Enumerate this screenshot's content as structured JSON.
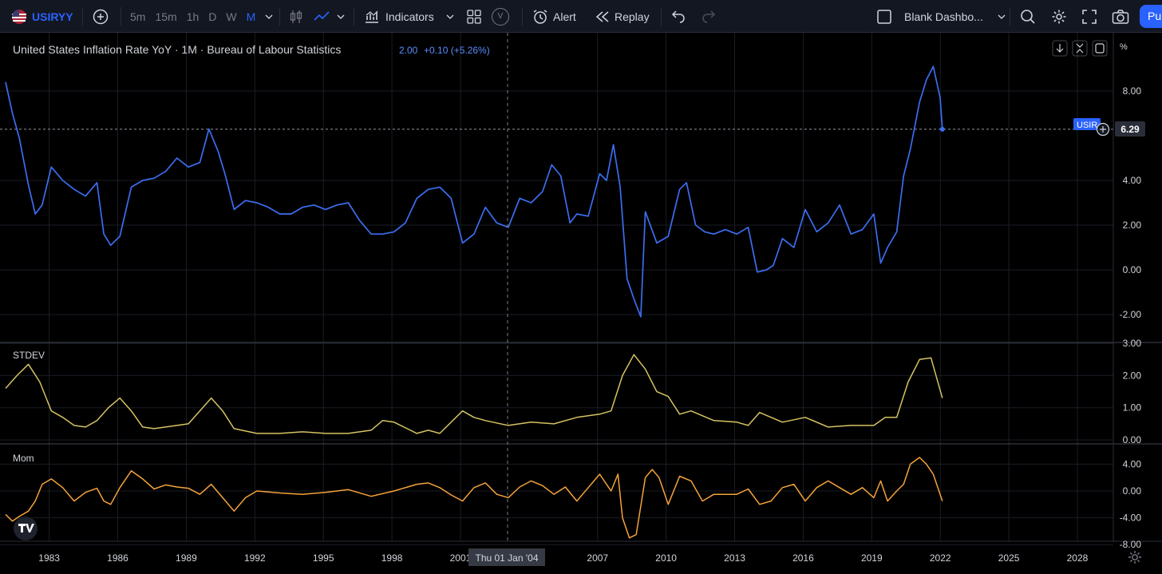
{
  "toolbar": {
    "symbol": "USIRYY",
    "timeframes": [
      "5m",
      "15m",
      "1h",
      "D",
      "W",
      "M"
    ],
    "active_timeframe": "M",
    "indicators_label": "Indicators",
    "v_label": "V",
    "alert_label": "Alert",
    "replay_label": "Replay",
    "layout_name": "Blank Dashbo...",
    "publish_label": "Pu"
  },
  "legend": {
    "title": "United States Inflation Rate YoY · 1M · Bureau of Labour Statistics",
    "last_value": "2.00",
    "change": "+0.10 (+5.26%)"
  },
  "price_axis_unit": "%",
  "current_price_label": "6.29",
  "current_tag": "USIR",
  "crosshair_label": "Thu 01 Jan '04",
  "colors": {
    "background": "#000000",
    "main_series": "#3b6ef0",
    "stdev_series": "#d4c361",
    "mom_series": "#f5a33a",
    "accent": "#2962ff"
  },
  "chart_data": [
    {
      "type": "line",
      "pane": "main",
      "title": "United States Inflation Rate YoY · 1M · Bureau of Labour Statistics",
      "ylim": [
        -2.5,
        10
      ],
      "yticks": [
        "8.00",
        "4.00",
        "2.00",
        "0.00",
        "-2.00"
      ],
      "x_ticks": [
        "1983",
        "1986",
        "1989",
        "1992",
        "1995",
        "1998",
        "2001",
        "2007",
        "2010",
        "2013",
        "2016",
        "2019",
        "2022",
        "2025",
        "2028"
      ],
      "x": [
        1982.0,
        1982.3,
        1982.6,
        1983.0,
        1983.3,
        1983.6,
        1984.0,
        1984.5,
        1985.0,
        1985.5,
        1986.0,
        1986.3,
        1986.6,
        1987.0,
        1987.5,
        1988.0,
        1988.5,
        1989.0,
        1989.5,
        1990.0,
        1990.5,
        1990.9,
        1991.3,
        1991.6,
        1992.0,
        1992.5,
        1993.0,
        1993.5,
        1994.0,
        1994.5,
        1995.0,
        1995.5,
        1996.0,
        1996.5,
        1997.0,
        1997.5,
        1998.0,
        1998.5,
        1999.0,
        1999.5,
        2000.0,
        2000.5,
        2001.0,
        2001.5,
        2002.0,
        2002.5,
        2003.0,
        2003.5,
        2004.0,
        2004.5,
        2005.0,
        2005.5,
        2005.9,
        2006.3,
        2006.7,
        2007.0,
        2007.5,
        2008.0,
        2008.3,
        2008.6,
        2008.9,
        2009.2,
        2009.5,
        2009.8,
        2010.0,
        2010.5,
        2011.0,
        2011.5,
        2011.8,
        2012.2,
        2012.6,
        2013.0,
        2013.5,
        2014.0,
        2014.5,
        2014.9,
        2015.3,
        2015.6,
        2016.0,
        2016.5,
        2017.0,
        2017.5,
        2018.0,
        2018.5,
        2019.0,
        2019.5,
        2020.0,
        2020.3,
        2020.6,
        2021.0,
        2021.3,
        2021.6,
        2022.0,
        2022.3,
        2022.6,
        2022.9,
        2023.0
      ],
      "y": [
        8.4,
        7.0,
        5.9,
        3.8,
        2.5,
        2.9,
        4.6,
        4.0,
        3.6,
        3.3,
        3.9,
        1.6,
        1.1,
        1.5,
        3.7,
        4.0,
        4.1,
        4.4,
        5.0,
        4.6,
        4.8,
        6.3,
        5.3,
        4.3,
        2.7,
        3.1,
        3.0,
        2.8,
        2.5,
        2.5,
        2.8,
        2.9,
        2.7,
        2.9,
        3.0,
        2.2,
        1.6,
        1.6,
        1.7,
        2.1,
        3.2,
        3.6,
        3.7,
        3.2,
        1.2,
        1.6,
        2.8,
        2.1,
        1.9,
        3.2,
        3.0,
        3.5,
        4.7,
        4.2,
        2.1,
        2.5,
        2.4,
        4.3,
        4.0,
        5.6,
        3.7,
        -0.4,
        -1.3,
        -2.1,
        2.6,
        1.2,
        1.5,
        3.6,
        3.9,
        2.0,
        1.7,
        1.6,
        1.8,
        1.6,
        1.9,
        -0.1,
        0.0,
        0.2,
        1.4,
        1.0,
        2.7,
        1.7,
        2.1,
        2.9,
        1.6,
        1.8,
        2.5,
        0.3,
        1.0,
        1.7,
        4.2,
        5.4,
        7.5,
        8.5,
        9.1,
        7.7,
        6.29
      ]
    },
    {
      "type": "line",
      "pane": "stdev",
      "title": "STDEV",
      "ylim": [
        0,
        3
      ],
      "yticks": [
        "3.00",
        "2.00",
        "1.00",
        "0.00"
      ],
      "x": [
        1982.0,
        1982.5,
        1983.0,
        1983.5,
        1984.0,
        1984.5,
        1985.0,
        1985.5,
        1986.0,
        1986.5,
        1987.0,
        1987.5,
        1988.0,
        1988.5,
        1989.0,
        1989.5,
        1990.0,
        1990.5,
        1991.0,
        1991.5,
        1992.0,
        1993.0,
        1994.0,
        1995.0,
        1996.0,
        1997.0,
        1998.0,
        1998.5,
        1999.0,
        2000.0,
        2000.5,
        2001.0,
        2002.0,
        2002.5,
        2003.0,
        2004.0,
        2005.0,
        2006.0,
        2007.0,
        2008.0,
        2008.5,
        2009.0,
        2009.5,
        2010.0,
        2010.5,
        2011.0,
        2011.5,
        2012.0,
        2013.0,
        2014.0,
        2014.5,
        2015.0,
        2016.0,
        2017.0,
        2018.0,
        2019.0,
        2020.0,
        2020.5,
        2021.0,
        2021.5,
        2022.0,
        2022.5,
        2023.0
      ],
      "y": [
        1.6,
        2.0,
        2.35,
        1.8,
        0.9,
        0.7,
        0.45,
        0.4,
        0.6,
        1.0,
        1.3,
        0.9,
        0.4,
        0.35,
        0.4,
        0.45,
        0.5,
        0.9,
        1.3,
        0.9,
        0.35,
        0.2,
        0.2,
        0.25,
        0.2,
        0.2,
        0.3,
        0.6,
        0.55,
        0.2,
        0.3,
        0.2,
        0.9,
        0.7,
        0.6,
        0.45,
        0.55,
        0.5,
        0.7,
        0.8,
        0.9,
        2.0,
        2.65,
        2.2,
        1.5,
        1.35,
        0.8,
        0.9,
        0.6,
        0.55,
        0.45,
        0.85,
        0.55,
        0.7,
        0.4,
        0.45,
        0.45,
        0.7,
        0.7,
        1.8,
        2.5,
        2.55,
        1.3
      ]
    },
    {
      "type": "line",
      "pane": "mom",
      "title": "Mom",
      "ylim": [
        -8,
        6
      ],
      "yticks": [
        "4.00",
        "0.00",
        "-4.00",
        "-8.00"
      ],
      "x": [
        1982.0,
        1982.3,
        1982.6,
        1983.0,
        1983.3,
        1983.6,
        1984.0,
        1984.5,
        1985.0,
        1985.5,
        1986.0,
        1986.3,
        1986.6,
        1987.0,
        1987.5,
        1988.0,
        1988.5,
        1989.0,
        1989.5,
        1990.0,
        1990.5,
        1991.0,
        1991.5,
        1992.0,
        1992.5,
        1993.0,
        1994.0,
        1995.0,
        1996.0,
        1997.0,
        1998.0,
        1999.0,
        2000.0,
        2000.5,
        2001.0,
        2001.5,
        2002.0,
        2002.5,
        2003.0,
        2003.5,
        2004.0,
        2004.5,
        2005.0,
        2005.5,
        2006.0,
        2006.5,
        2007.0,
        2007.5,
        2008.0,
        2008.5,
        2008.8,
        2009.0,
        2009.3,
        2009.6,
        2010.0,
        2010.3,
        2010.6,
        2011.0,
        2011.5,
        2012.0,
        2012.5,
        2013.0,
        2013.5,
        2014.0,
        2014.5,
        2015.0,
        2015.5,
        2016.0,
        2016.5,
        2017.0,
        2017.5,
        2018.0,
        2018.5,
        2019.0,
        2019.5,
        2020.0,
        2020.3,
        2020.6,
        2021.0,
        2021.3,
        2021.6,
        2022.0,
        2022.3,
        2022.6,
        2023.0
      ],
      "y": [
        -3.5,
        -4.5,
        -3.8,
        -3.0,
        -1.5,
        1.0,
        1.8,
        0.5,
        -1.5,
        -0.2,
        0.4,
        -1.5,
        -2.0,
        0.5,
        3.0,
        1.8,
        0.3,
        0.9,
        0.6,
        0.4,
        -0.5,
        1.0,
        -1.0,
        -3.0,
        -1.0,
        0.0,
        -0.3,
        -0.5,
        -0.2,
        0.2,
        -0.8,
        0.0,
        1.0,
        1.2,
        0.5,
        -0.6,
        -1.5,
        0.5,
        1.2,
        -0.5,
        -1.0,
        0.6,
        1.5,
        0.8,
        -0.5,
        0.6,
        -1.5,
        0.5,
        2.5,
        0.0,
        2.5,
        -4.0,
        -7.0,
        -6.5,
        2.0,
        3.2,
        2.0,
        -2.0,
        2.2,
        1.5,
        -1.5,
        -0.5,
        -0.5,
        -0.5,
        0.3,
        -2.0,
        -1.5,
        0.5,
        1.0,
        -1.5,
        0.5,
        1.5,
        0.5,
        -0.5,
        0.5,
        -1.0,
        1.5,
        -1.5,
        0.0,
        1.0,
        4.0,
        5.0,
        4.0,
        2.5,
        -1.5
      ]
    }
  ]
}
